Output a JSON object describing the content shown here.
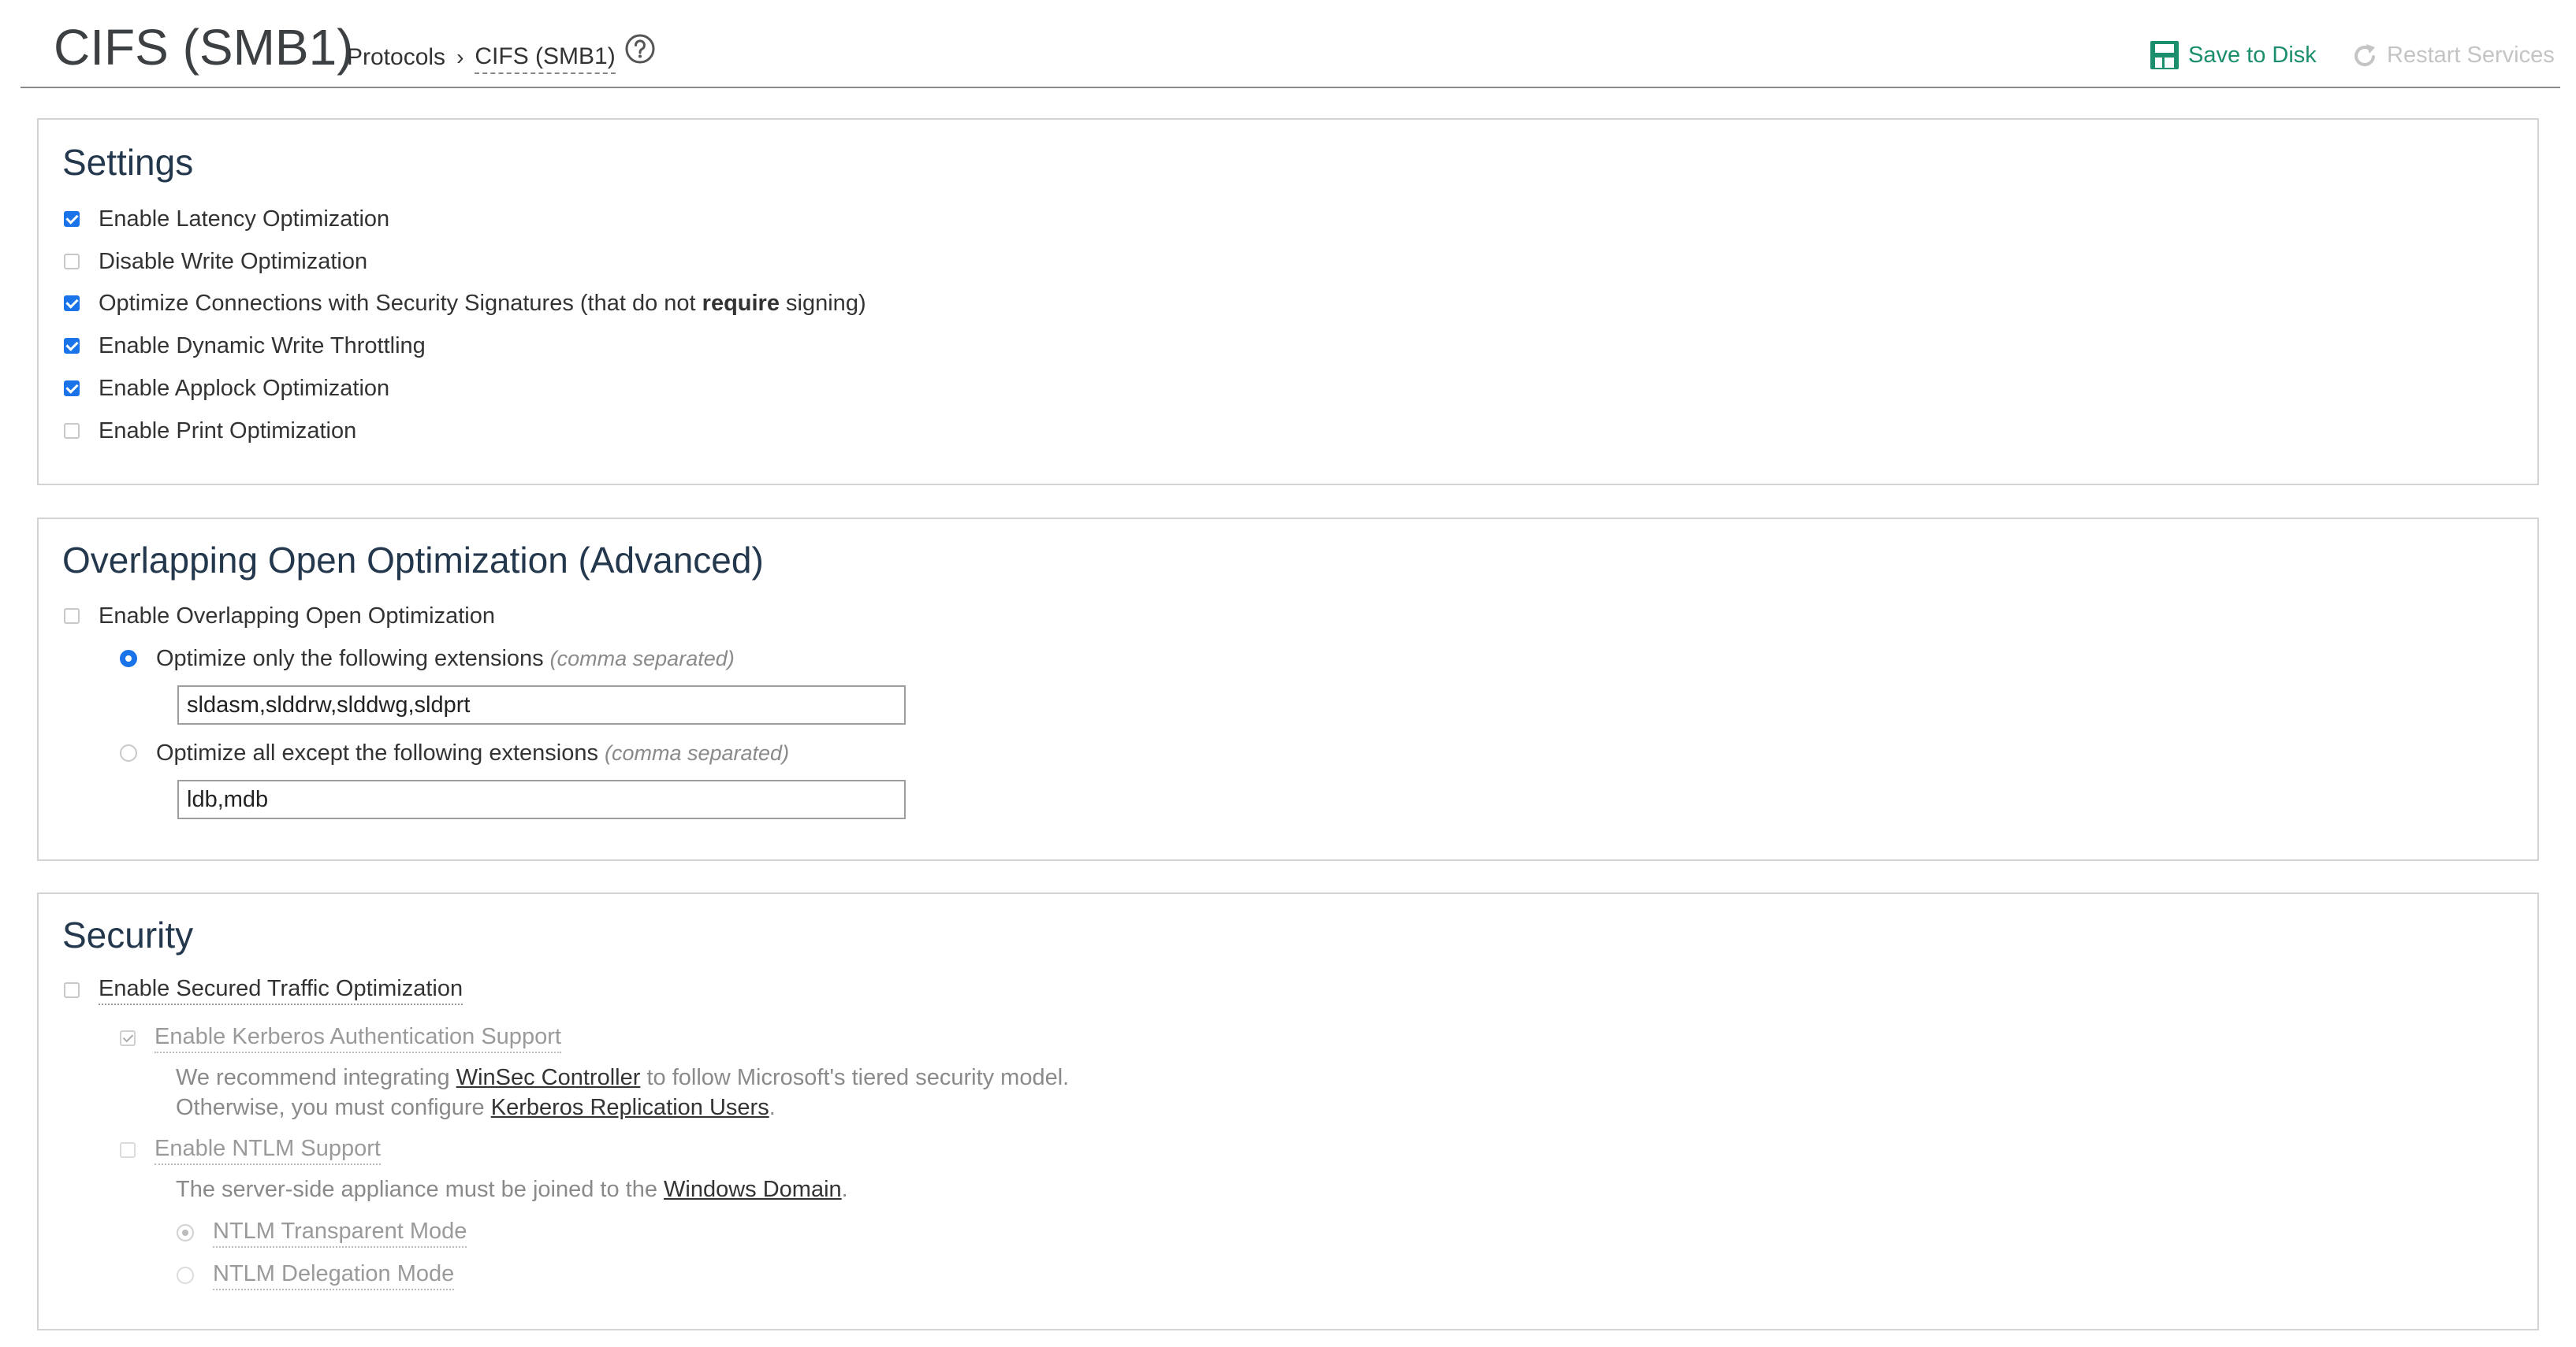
{
  "header": {
    "title": "CIFS (SMB1)",
    "breadcrumb": {
      "parent": "Protocols",
      "separator": "›",
      "current": "CIFS (SMB1)"
    },
    "help_icon": "question-circle-icon",
    "save_label": "Save to Disk",
    "restart_label": "Restart Services"
  },
  "colors": {
    "accent": "#1a73e8",
    "save_green": "#1a8e6d",
    "title_navy": "#23374d",
    "disabled": "#c4c4c4"
  },
  "settings": {
    "title": "Settings",
    "items": [
      {
        "label": "Enable Latency Optimization",
        "checked": true
      },
      {
        "label": "Disable Write Optimization",
        "checked": false
      },
      {
        "label": "Optimize Connections with Security Signatures (that do not ",
        "bold": "require",
        "suffix": " signing)",
        "checked": true
      },
      {
        "label": "Enable Dynamic Write Throttling",
        "checked": true
      },
      {
        "label": "Enable Applock Optimization",
        "checked": true
      },
      {
        "label": "Enable Print Optimization",
        "checked": false
      }
    ]
  },
  "overlap": {
    "title": "Overlapping Open Optimization (Advanced)",
    "enable_label": "Enable Overlapping Open Optimization",
    "enable_checked": false,
    "option_only": {
      "label": "Optimize only the following extensions",
      "hint": "(comma separated)",
      "selected": true,
      "value": "sldasm,slddrw,slddwg,sldprt"
    },
    "option_except": {
      "label": "Optimize all except the following extensions",
      "hint": "(comma separated)",
      "selected": false,
      "value": "ldb,mdb"
    }
  },
  "security": {
    "title": "Security",
    "secured_label": "Enable Secured Traffic Optimization",
    "secured_checked": false,
    "kerberos": {
      "label": "Enable Kerberos Authentication Support",
      "checked": true,
      "note1_pre": "We recommend integrating ",
      "note1_link": "WinSec Controller",
      "note1_post": " to follow Microsoft's tiered security model.",
      "note2_pre": "Otherwise, you must configure ",
      "note2_link": "Kerberos Replication Users",
      "note2_post": "."
    },
    "ntlm": {
      "label": "Enable NTLM Support",
      "checked": false,
      "note_pre": "The server-side appliance must be joined to the ",
      "note_link": "Windows Domain",
      "note_post": ".",
      "transparent": {
        "label": "NTLM Transparent Mode",
        "selected": true
      },
      "delegation": {
        "label": "NTLM Delegation Mode",
        "selected": false
      }
    }
  }
}
